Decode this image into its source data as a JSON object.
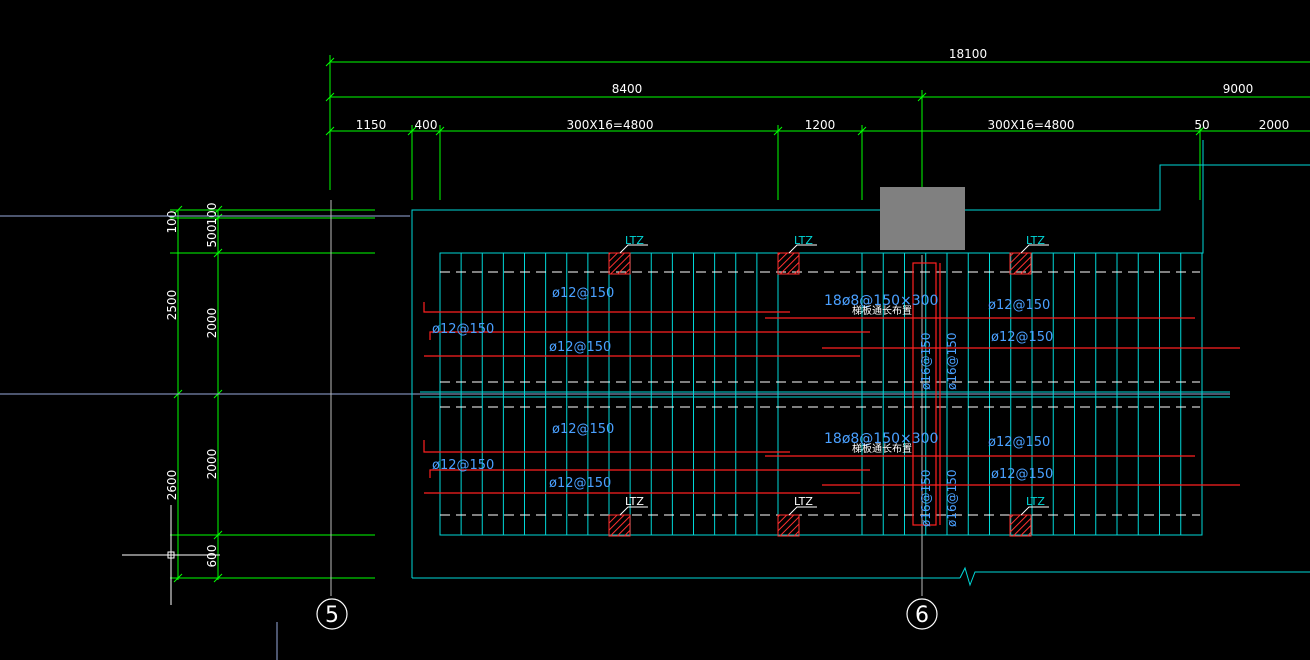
{
  "colors": {
    "background": "#000000",
    "dimension": "#00ff00",
    "outline": "#00ffff",
    "rebar": "#ff2020",
    "label_blue": "#4aa0ff",
    "text_white": "#ffffff",
    "column_fill": "#808080",
    "ltz_hatch": "#ff3030"
  },
  "dimensions": {
    "top_overall": "18100",
    "top_left_seg": "8400",
    "top_right_seg": "9000",
    "d_1150": "1150",
    "d_400": "400",
    "d_left_spacing": "300X16=4800",
    "d_1200": "1200",
    "d_right_spacing": "300X16=4800",
    "d_50": "50",
    "d_2000": "2000",
    "v_100": "100",
    "v_500": "500",
    "v_100b": "100",
    "v_2500": "2500",
    "v_2000a": "2000",
    "v_2000b": "2000",
    "v_2600": "2600",
    "v_600": "600"
  },
  "axes": {
    "axis_5": "5",
    "axis_6": "6"
  },
  "ltz_label": "LTZ",
  "rebar_labels": {
    "top_a": "ø12@150",
    "top_b": "ø12@150",
    "top_left": "ø12@150",
    "top_r1": "ø12@150",
    "top_r2": "ø12@150",
    "bot_a": "ø12@150",
    "bot_b": "ø12@150",
    "bot_left": "ø12@150",
    "bot_r1": "ø12@150",
    "bot_r2": "ø12@150",
    "stirrup_top": "18ø8@150×300",
    "stirrup_bot": "18ø8@150×300",
    "stirrup_note_top": "梯板通长布置",
    "stirrup_note_bot": "梯板通长布置",
    "v16a": "ø16@150",
    "v16b": "ø16@150",
    "v16c": "ø16@150",
    "v16d": "ø16@150"
  }
}
